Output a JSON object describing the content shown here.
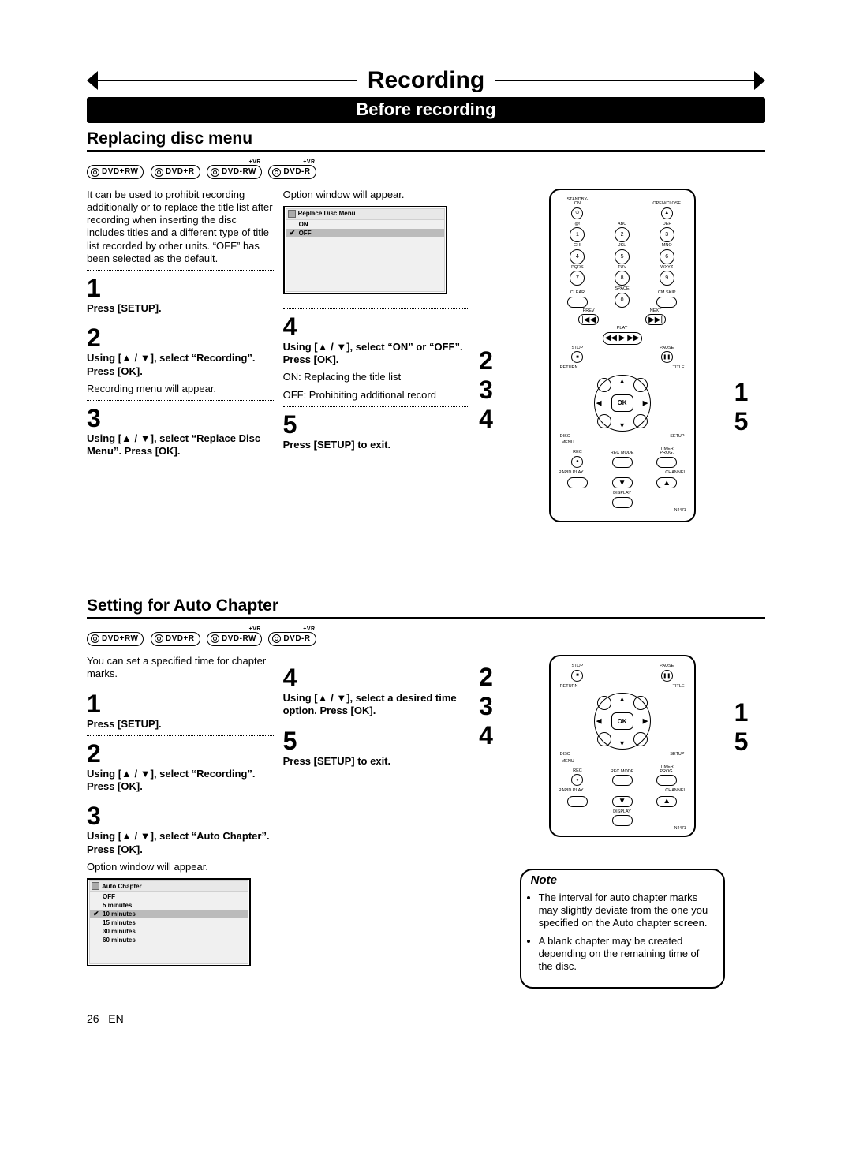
{
  "header": {
    "title": "Recording",
    "subtitle": "Before recording"
  },
  "section1": {
    "title": "Replacing disc menu",
    "badges": [
      "DVD+RW",
      "DVD+R",
      "DVD-RW",
      "DVD-R"
    ],
    "vr_badges": [
      false,
      false,
      true,
      true
    ],
    "intro": "It can be used to prohibit recording additionally or to replace the title list after recording when inserting the disc includes titles and a different type of title list recorded by other units. “OFF” has been selected as the default.",
    "steps_a": [
      {
        "n": "1",
        "bold": "Press [SETUP].",
        "plain": ""
      },
      {
        "n": "2",
        "bold": "Using [▲ / ▼], select “Recording”. Press [OK].",
        "plain": "Recording menu will appear."
      },
      {
        "n": "3",
        "bold": "Using [▲ / ▼], select “Replace Disc Menu”. Press [OK].",
        "plain": ""
      }
    ],
    "col2_lead": "Option window will appear.",
    "screen": {
      "title": "Replace Disc Menu",
      "options": [
        "ON",
        "OFF"
      ],
      "selected_index": 1
    },
    "steps_b": [
      {
        "n": "4",
        "bold": "Using [▲ / ▼], select “ON” or “OFF”. Press [OK].",
        "plain_lines": [
          "ON:  Replacing the title list",
          "OFF: Prohibiting additional record"
        ]
      },
      {
        "n": "5",
        "bold": "Press [SETUP] to exit.",
        "plain_lines": []
      }
    ],
    "annotations_left": [
      "2",
      "3",
      "4"
    ],
    "annotations_right": [
      "1",
      "5"
    ]
  },
  "section2": {
    "title": "Setting for Auto Chapter",
    "badges": [
      "DVD+RW",
      "DVD+R",
      "DVD-RW",
      "DVD-R"
    ],
    "vr_badges": [
      false,
      false,
      true,
      true
    ],
    "intro": "You can set a specified time for chapter marks.",
    "steps_a": [
      {
        "n": "1",
        "bold": "Press [SETUP].",
        "plain": ""
      },
      {
        "n": "2",
        "bold": "Using [▲ / ▼], select “Recording”. Press [OK].",
        "plain": ""
      },
      {
        "n": "3",
        "bold": "Using [▲ / ▼], select “Auto Chapter”. Press [OK].",
        "plain": "Option window will appear."
      }
    ],
    "screen": {
      "title": "Auto Chapter",
      "options": [
        "OFF",
        "5 minutes",
        "10 minutes",
        "15 minutes",
        "30 minutes",
        "60 minutes"
      ],
      "selected_index": 2
    },
    "steps_b": [
      {
        "n": "4",
        "bold": "Using [▲ / ▼], select a desired time option. Press [OK].",
        "plain": ""
      },
      {
        "n": "5",
        "bold": "Press [SETUP] to exit.",
        "plain": ""
      }
    ],
    "annotations_left": [
      "2",
      "3",
      "4"
    ],
    "annotations_right": [
      "1",
      "5"
    ]
  },
  "note": {
    "label": "Note",
    "items": [
      "The interval for auto chapter marks may slightly deviate from the one you specified on the Auto chapter screen.",
      "A blank chapter may be created depending on the remaining time of the disc."
    ]
  },
  "remote": {
    "row_labels": {
      "r1": [
        "STANDBY-ON",
        "OPEN/CLOSE"
      ],
      "r2": [
        "@!",
        "ABC",
        "DEF"
      ],
      "n2": [
        "1",
        "2",
        "3"
      ],
      "r3": [
        "GHI",
        "JKL",
        "MNO"
      ],
      "n3": [
        "4",
        "5",
        "6"
      ],
      "r4": [
        "PQRS",
        "TUV",
        "WXYZ"
      ],
      "n4": [
        "7",
        "8",
        "9"
      ],
      "r5": [
        "CLEAR",
        "SPACE",
        "CM SKIP"
      ],
      "n5": [
        "",
        "0",
        ""
      ],
      "prevnext": [
        "PREV",
        "NEXT"
      ],
      "play": "PLAY",
      "stop": "STOP",
      "pause": "PAUSE",
      "return": "RETURN",
      "title": "TITLE",
      "disc": "DISC",
      "setup": "SETUP",
      "menu": "MENU",
      "rec": "REC",
      "recmode": "REC MODE",
      "timer": "TIMER PROG.",
      "rapid": "RAPID PLAY",
      "channel": "CHANNEL",
      "display": "DISPLAY",
      "corner": "N4471"
    },
    "ok": "OK"
  },
  "footer": {
    "page": "26",
    "lang": "EN"
  }
}
